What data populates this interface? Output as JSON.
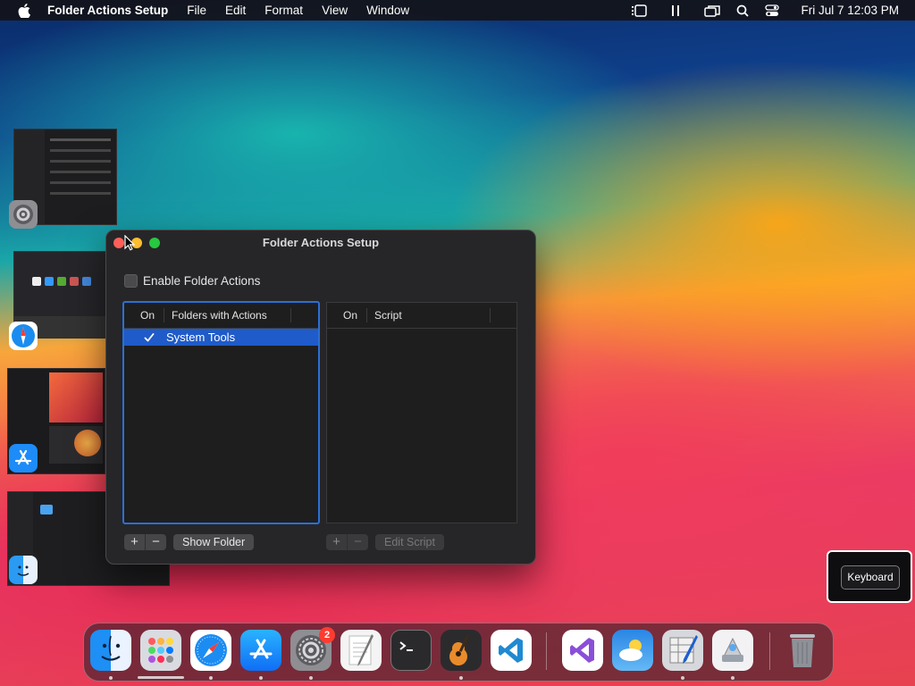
{
  "menubar": {
    "app_name": "Folder Actions Setup",
    "menus": [
      "File",
      "Edit",
      "Format",
      "View",
      "Window"
    ],
    "clock": "Fri Jul 7  12:03 PM"
  },
  "window": {
    "title": "Folder Actions Setup",
    "enable_label": "Enable Folder Actions",
    "enable_checked": false,
    "folders_table": {
      "headers": [
        "On",
        "Folders with Actions"
      ],
      "rows": [
        {
          "on": true,
          "name": "System Tools",
          "selected": true
        }
      ]
    },
    "scripts_table": {
      "headers": [
        "On",
        "Script"
      ],
      "rows": []
    },
    "buttons": {
      "add": "+",
      "remove": "−",
      "show_folder": "Show Folder",
      "edit_script": "Edit Script"
    }
  },
  "keyboard_hud": {
    "label": "Keyboard"
  },
  "dock": {
    "badge_system_settings": "2",
    "items": [
      "finder-icon",
      "launchpad-icon",
      "safari-icon",
      "app-store-icon",
      "system-settings-icon",
      "textedit-icon",
      "terminal-icon",
      "garageband-icon",
      "vscode-icon",
      "visual-studio-icon",
      "weather-icon",
      "script-editor-icon",
      "automator-icon",
      "trash-icon"
    ]
  }
}
